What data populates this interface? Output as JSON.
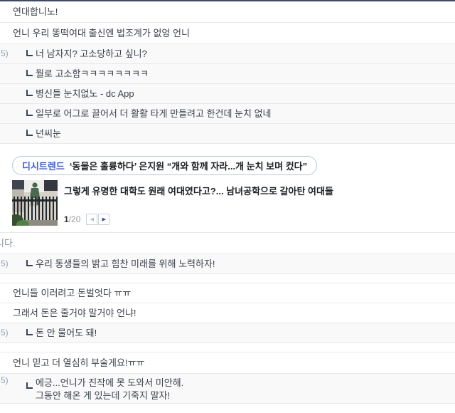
{
  "comments_top": [
    {
      "text": "연대합니노!"
    },
    {
      "text": "언니 우리 똥떡여대 출신엔 법조계가 없엉 언니"
    },
    {
      "marker": "5)",
      "text": "너 남자지? 고소당하고 싶니?"
    },
    {
      "text": "뭘로 고소함ㅋㅋㅋㅋㅋㅋㅋㅋ"
    },
    {
      "text": "병신들 눈치없노 - dc App"
    },
    {
      "text": "일부로 어그로 끌어서 더 활활 타게 만들려고 한건데 눈치 없네"
    },
    {
      "text": "넌씨눈"
    }
  ],
  "trend_widget": {
    "badge_label": "디시트렌드",
    "headline": "‘동물은 훌륭하다’ 은지원 “개와 함께 자라...개 눈치 보며 컸다”",
    "article_title": "그렇게 유명한 대학도 원래 여대였다고?... 남녀공학으로 갈아탄 여대들",
    "page_current": "1",
    "page_total": "/20",
    "prev_arrow": "◀",
    "next_arrow": "▶"
  },
  "comments_bottom": [
    {
      "text": "니다."
    },
    {
      "marker": "5)",
      "text": "우리 동생들의 밝고 힘찬 미래를 위해 노력하자!"
    },
    {
      "text": "언니들 이러려고 돈벌엇다 ㅠㅠ"
    },
    {
      "text": "그래서 돈은 줄거야 말거야 언냐!"
    },
    {
      "marker": "5)",
      "text": "돈 안 물어도 돼!"
    },
    {
      "text": "언니 믿고 더 열심히 부술게요!ㅠㅠ"
    },
    {
      "marker": "5)",
      "text": "에긍...언니가 진작에 못 도와서 미안해.",
      "text2": "그동안 해온 게 있는데 기죽지 말자!"
    }
  ],
  "colors": {
    "top_bar": "#3e4a6d",
    "reply_row_bg": "#f9f9f9",
    "row_border": "#e9e9e9",
    "trend_badge_blue": "#3b5be0",
    "reply_icon": "#3a4158",
    "ip_marker": "#94a0b4"
  }
}
